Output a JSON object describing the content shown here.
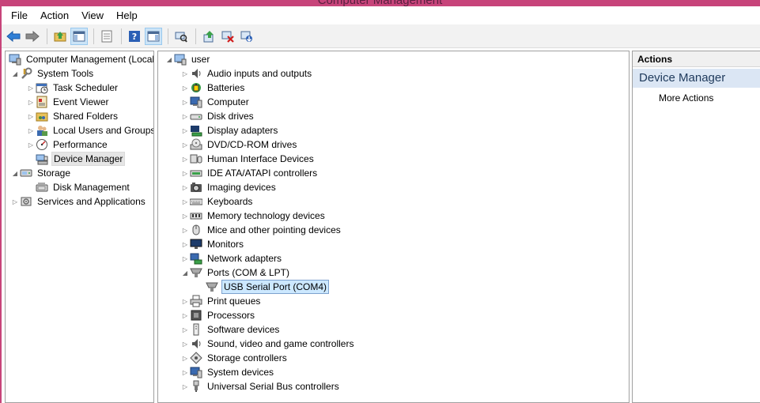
{
  "window": {
    "title": "Computer Management"
  },
  "menu": [
    "File",
    "Action",
    "View",
    "Help"
  ],
  "toolbar": {
    "buttons": [
      "back-icon",
      "forward-icon",
      "up-folder-icon",
      "show-hide-console-tree-icon",
      "properties-icon",
      "help-icon",
      "show-action-pane-icon",
      "scan-hardware-icon",
      "update-driver-icon",
      "disable-device-icon",
      "uninstall-device-icon"
    ]
  },
  "left_tree": [
    {
      "label": "Computer Management (Local",
      "level": 0,
      "expander": "",
      "icon": "computer-management-icon"
    },
    {
      "label": "System Tools",
      "level": 1,
      "expander": "open",
      "icon": "system-tools-icon"
    },
    {
      "label": "Task Scheduler",
      "level": 2,
      "expander": "closed",
      "icon": "task-scheduler-icon"
    },
    {
      "label": "Event Viewer",
      "level": 2,
      "expander": "closed",
      "icon": "event-viewer-icon"
    },
    {
      "label": "Shared Folders",
      "level": 2,
      "expander": "closed",
      "icon": "shared-folders-icon"
    },
    {
      "label": "Local Users and Groups",
      "level": 2,
      "expander": "closed",
      "icon": "local-users-icon"
    },
    {
      "label": "Performance",
      "level": 2,
      "expander": "closed",
      "icon": "performance-icon"
    },
    {
      "label": "Device Manager",
      "level": 2,
      "expander": "",
      "icon": "device-manager-icon",
      "selected": true
    },
    {
      "label": "Storage",
      "level": 1,
      "expander": "open",
      "icon": "storage-icon"
    },
    {
      "label": "Disk Management",
      "level": 2,
      "expander": "",
      "icon": "disk-management-icon"
    },
    {
      "label": "Services and Applications",
      "level": 1,
      "expander": "closed",
      "icon": "services-icon"
    }
  ],
  "device_tree": {
    "root": "user",
    "categories": [
      {
        "label": "Audio inputs and outputs",
        "icon": "speaker-icon"
      },
      {
        "label": "Batteries",
        "icon": "battery-icon"
      },
      {
        "label": "Computer",
        "icon": "computer-icon"
      },
      {
        "label": "Disk drives",
        "icon": "disk-drive-icon"
      },
      {
        "label": "Display adapters",
        "icon": "display-adapter-icon"
      },
      {
        "label": "DVD/CD-ROM drives",
        "icon": "dvd-icon"
      },
      {
        "label": "Human Interface Devices",
        "icon": "hid-icon"
      },
      {
        "label": "IDE ATA/ATAPI controllers",
        "icon": "ide-controller-icon"
      },
      {
        "label": "Imaging devices",
        "icon": "camera-icon"
      },
      {
        "label": "Keyboards",
        "icon": "keyboard-icon"
      },
      {
        "label": "Memory technology devices",
        "icon": "memory-icon"
      },
      {
        "label": "Mice and other pointing devices",
        "icon": "mouse-icon"
      },
      {
        "label": "Monitors",
        "icon": "monitor-icon"
      },
      {
        "label": "Network adapters",
        "icon": "network-adapter-icon"
      },
      {
        "label": "Ports (COM & LPT)",
        "icon": "port-icon",
        "expanded": true,
        "children": [
          {
            "label": "USB Serial Port (COM4)",
            "icon": "port-icon",
            "selected": true
          }
        ]
      },
      {
        "label": "Print queues",
        "icon": "printer-icon"
      },
      {
        "label": "Processors",
        "icon": "processor-icon"
      },
      {
        "label": "Software devices",
        "icon": "software-device-icon"
      },
      {
        "label": "Sound, video and game controllers",
        "icon": "sound-icon"
      },
      {
        "label": "Storage controllers",
        "icon": "storage-controller-icon"
      },
      {
        "label": "System devices",
        "icon": "system-devices-icon"
      },
      {
        "label": "Universal Serial Bus controllers",
        "icon": "usb-icon"
      }
    ]
  },
  "actions": {
    "header": "Actions",
    "section": "Device Manager",
    "items": [
      "More Actions"
    ]
  }
}
